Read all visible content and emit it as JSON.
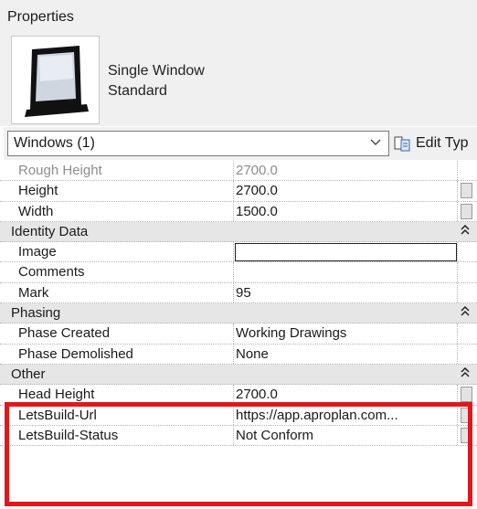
{
  "panel": {
    "title": "Properties"
  },
  "type_preview": {
    "line1": "Single Window",
    "line2": "Standard"
  },
  "selector": {
    "value": "Windows (1)",
    "edit_type_label": "Edit Typ"
  },
  "rows": [
    {
      "kind": "param",
      "label": "Rough Height",
      "value": "2700.0",
      "greyed": true
    },
    {
      "kind": "param",
      "label": "Height",
      "value": "2700.0",
      "button": true
    },
    {
      "kind": "param",
      "label": "Width",
      "value": "1500.0",
      "button": true
    },
    {
      "kind": "group",
      "label": "Identity Data"
    },
    {
      "kind": "param",
      "label": "Image",
      "value": "",
      "editing": true
    },
    {
      "kind": "param",
      "label": "Comments",
      "value": ""
    },
    {
      "kind": "param",
      "label": "Mark",
      "value": "95"
    },
    {
      "kind": "group",
      "label": "Phasing"
    },
    {
      "kind": "param",
      "label": "Phase Created",
      "value": "Working Drawings"
    },
    {
      "kind": "param",
      "label": "Phase Demolished",
      "value": "None"
    },
    {
      "kind": "group",
      "label": "Other"
    },
    {
      "kind": "param",
      "label": "Head Height",
      "value": "2700.0",
      "button": true
    },
    {
      "kind": "param",
      "label": "LetsBuild-Url",
      "value": "https://app.aproplan.com...",
      "button": true
    },
    {
      "kind": "param",
      "label": "LetsBuild-Status",
      "value": "Not Conform",
      "button": true
    }
  ],
  "colors": {
    "highlight": "#e3161b",
    "group_bg": "#e6e6e6",
    "panel_bg": "#f0f0f0"
  }
}
